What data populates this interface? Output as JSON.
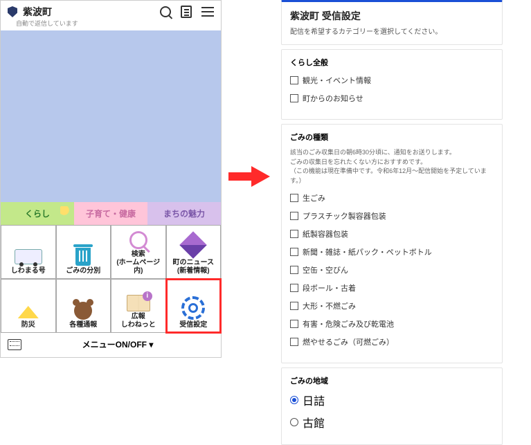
{
  "phone": {
    "title": "紫波町",
    "subtitle": "自動で返信しています",
    "tabs": {
      "kurashi": "くらし",
      "kosodate": "子育て・健康",
      "machi": "まちの魅力"
    },
    "cells": {
      "bus": "しわまる号",
      "bin": "ごみの分別",
      "search": "検索\n(ホームページ内)",
      "news": "町のニュース\n(新着情報)",
      "bosai": "防災",
      "tsuho": "各種通報",
      "koho": "広報\nしわねっと",
      "jushin": "受信設定"
    },
    "menu_toggle": "メニューON/OFF ▾"
  },
  "settings": {
    "title": "紫波町 受信設定",
    "subtitle": "配信を希望するカテゴリーを選択してください。",
    "sec_general_title": "くらし全般",
    "general": {
      "kanko": "観光・イベント情報",
      "oshirase": "町からのお知らせ"
    },
    "sec_gomi_title": "ごみの種類",
    "sec_gomi_note1": "該当のごみ収集日の朝6時30分頃に、通知をお送りします。",
    "sec_gomi_note2": "ごみの収集日を忘れたくない方におすすめです。",
    "sec_gomi_note3": "（この機能は現在準備中です。令和6年12月〜配信開始を予定しています。）",
    "gomi": {
      "nama": "生ごみ",
      "pla": "プラスチック製容器包装",
      "kami": "紙製容器包装",
      "shinbun": "新聞・雑誌・紙パック・ペットボトル",
      "kan": "空缶・空びん",
      "dan": "段ボール・古着",
      "ogata": "大形・不燃ごみ",
      "yugai": "有害・危険ごみ及び乾電池",
      "moyaseru": "燃やせるごみ（可燃ごみ）"
    },
    "sec_chiiki_title": "ごみの地域",
    "chiiki": {
      "hizume": "日詰",
      "kotate": "古館"
    }
  }
}
